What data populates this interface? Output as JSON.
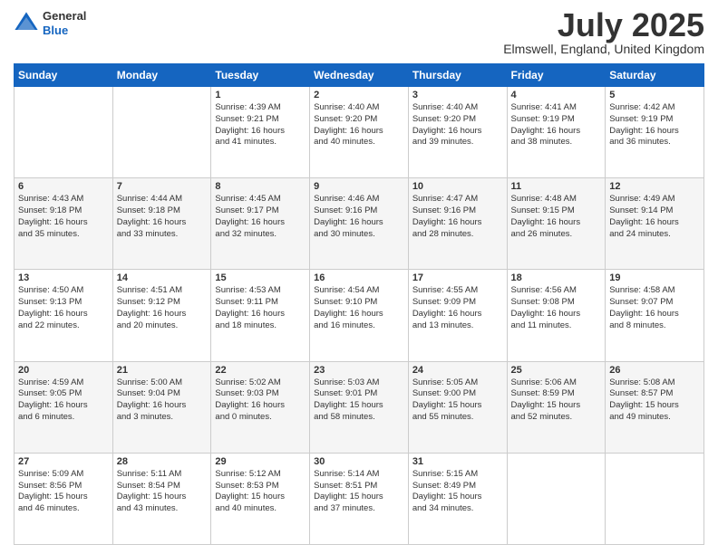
{
  "header": {
    "logo_general": "General",
    "logo_blue": "Blue",
    "month_title": "July 2025",
    "location": "Elmswell, England, United Kingdom"
  },
  "days_of_week": [
    "Sunday",
    "Monday",
    "Tuesday",
    "Wednesday",
    "Thursday",
    "Friday",
    "Saturday"
  ],
  "weeks": [
    [
      {
        "day": "",
        "text": ""
      },
      {
        "day": "",
        "text": ""
      },
      {
        "day": "1",
        "text": "Sunrise: 4:39 AM\nSunset: 9:21 PM\nDaylight: 16 hours\nand 41 minutes."
      },
      {
        "day": "2",
        "text": "Sunrise: 4:40 AM\nSunset: 9:20 PM\nDaylight: 16 hours\nand 40 minutes."
      },
      {
        "day": "3",
        "text": "Sunrise: 4:40 AM\nSunset: 9:20 PM\nDaylight: 16 hours\nand 39 minutes."
      },
      {
        "day": "4",
        "text": "Sunrise: 4:41 AM\nSunset: 9:19 PM\nDaylight: 16 hours\nand 38 minutes."
      },
      {
        "day": "5",
        "text": "Sunrise: 4:42 AM\nSunset: 9:19 PM\nDaylight: 16 hours\nand 36 minutes."
      }
    ],
    [
      {
        "day": "6",
        "text": "Sunrise: 4:43 AM\nSunset: 9:18 PM\nDaylight: 16 hours\nand 35 minutes."
      },
      {
        "day": "7",
        "text": "Sunrise: 4:44 AM\nSunset: 9:18 PM\nDaylight: 16 hours\nand 33 minutes."
      },
      {
        "day": "8",
        "text": "Sunrise: 4:45 AM\nSunset: 9:17 PM\nDaylight: 16 hours\nand 32 minutes."
      },
      {
        "day": "9",
        "text": "Sunrise: 4:46 AM\nSunset: 9:16 PM\nDaylight: 16 hours\nand 30 minutes."
      },
      {
        "day": "10",
        "text": "Sunrise: 4:47 AM\nSunset: 9:16 PM\nDaylight: 16 hours\nand 28 minutes."
      },
      {
        "day": "11",
        "text": "Sunrise: 4:48 AM\nSunset: 9:15 PM\nDaylight: 16 hours\nand 26 minutes."
      },
      {
        "day": "12",
        "text": "Sunrise: 4:49 AM\nSunset: 9:14 PM\nDaylight: 16 hours\nand 24 minutes."
      }
    ],
    [
      {
        "day": "13",
        "text": "Sunrise: 4:50 AM\nSunset: 9:13 PM\nDaylight: 16 hours\nand 22 minutes."
      },
      {
        "day": "14",
        "text": "Sunrise: 4:51 AM\nSunset: 9:12 PM\nDaylight: 16 hours\nand 20 minutes."
      },
      {
        "day": "15",
        "text": "Sunrise: 4:53 AM\nSunset: 9:11 PM\nDaylight: 16 hours\nand 18 minutes."
      },
      {
        "day": "16",
        "text": "Sunrise: 4:54 AM\nSunset: 9:10 PM\nDaylight: 16 hours\nand 16 minutes."
      },
      {
        "day": "17",
        "text": "Sunrise: 4:55 AM\nSunset: 9:09 PM\nDaylight: 16 hours\nand 13 minutes."
      },
      {
        "day": "18",
        "text": "Sunrise: 4:56 AM\nSunset: 9:08 PM\nDaylight: 16 hours\nand 11 minutes."
      },
      {
        "day": "19",
        "text": "Sunrise: 4:58 AM\nSunset: 9:07 PM\nDaylight: 16 hours\nand 8 minutes."
      }
    ],
    [
      {
        "day": "20",
        "text": "Sunrise: 4:59 AM\nSunset: 9:05 PM\nDaylight: 16 hours\nand 6 minutes."
      },
      {
        "day": "21",
        "text": "Sunrise: 5:00 AM\nSunset: 9:04 PM\nDaylight: 16 hours\nand 3 minutes."
      },
      {
        "day": "22",
        "text": "Sunrise: 5:02 AM\nSunset: 9:03 PM\nDaylight: 16 hours\nand 0 minutes."
      },
      {
        "day": "23",
        "text": "Sunrise: 5:03 AM\nSunset: 9:01 PM\nDaylight: 15 hours\nand 58 minutes."
      },
      {
        "day": "24",
        "text": "Sunrise: 5:05 AM\nSunset: 9:00 PM\nDaylight: 15 hours\nand 55 minutes."
      },
      {
        "day": "25",
        "text": "Sunrise: 5:06 AM\nSunset: 8:59 PM\nDaylight: 15 hours\nand 52 minutes."
      },
      {
        "day": "26",
        "text": "Sunrise: 5:08 AM\nSunset: 8:57 PM\nDaylight: 15 hours\nand 49 minutes."
      }
    ],
    [
      {
        "day": "27",
        "text": "Sunrise: 5:09 AM\nSunset: 8:56 PM\nDaylight: 15 hours\nand 46 minutes."
      },
      {
        "day": "28",
        "text": "Sunrise: 5:11 AM\nSunset: 8:54 PM\nDaylight: 15 hours\nand 43 minutes."
      },
      {
        "day": "29",
        "text": "Sunrise: 5:12 AM\nSunset: 8:53 PM\nDaylight: 15 hours\nand 40 minutes."
      },
      {
        "day": "30",
        "text": "Sunrise: 5:14 AM\nSunset: 8:51 PM\nDaylight: 15 hours\nand 37 minutes."
      },
      {
        "day": "31",
        "text": "Sunrise: 5:15 AM\nSunset: 8:49 PM\nDaylight: 15 hours\nand 34 minutes."
      },
      {
        "day": "",
        "text": ""
      },
      {
        "day": "",
        "text": ""
      }
    ]
  ]
}
